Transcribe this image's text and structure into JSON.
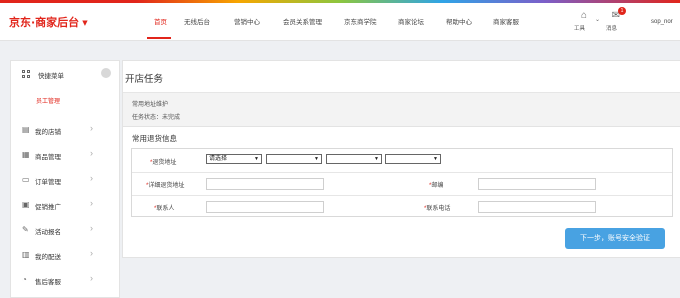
{
  "header": {
    "logo": "京东·商家后台",
    "nav": [
      {
        "label": "首页",
        "active": true
      },
      {
        "label": "无线后台"
      },
      {
        "label": "营销中心"
      },
      {
        "label": "会员关系管理"
      },
      {
        "label": "京东商学院"
      },
      {
        "label": "商家论坛"
      },
      {
        "label": "帮助中心"
      },
      {
        "label": "商家客服"
      }
    ],
    "tools_label": "工具",
    "messages_label": "消息",
    "messages_badge": "1",
    "user": "sop_nor"
  },
  "sidebar": {
    "quick_menu": "快捷菜单",
    "sub_item": "员工管理",
    "items": [
      {
        "label": "我的店铺",
        "icon": "store-icon"
      },
      {
        "label": "商品管理",
        "icon": "product-icon"
      },
      {
        "label": "订单管理",
        "icon": "order-icon"
      },
      {
        "label": "促销推广",
        "icon": "promotion-icon"
      },
      {
        "label": "活动报名",
        "icon": "activity-icon"
      },
      {
        "label": "我的配送",
        "icon": "delivery-icon"
      },
      {
        "label": "售后客服",
        "icon": "aftersale-icon"
      }
    ]
  },
  "main": {
    "title": "开店任务",
    "info_line1": "常用地址维护",
    "info_line2": "任务状态：未完成",
    "section_title": "常用退货信息",
    "form": {
      "address_label": "退货地址",
      "address_select_1": "请选择",
      "address_select_2": "",
      "address_select_3": "",
      "address_select_4": "",
      "detail_label": "详细退货地址",
      "detail_value": "",
      "zip_label": "邮编",
      "zip_value": "",
      "contact_label": "联系人",
      "contact_value": "",
      "phone_label": "联系电话",
      "phone_value": "",
      "required_mark": "*"
    },
    "submit_label": "下一步，账号安全验证"
  },
  "colors": {
    "brand_red": "#e1251b",
    "button_blue": "#48a2e2"
  }
}
